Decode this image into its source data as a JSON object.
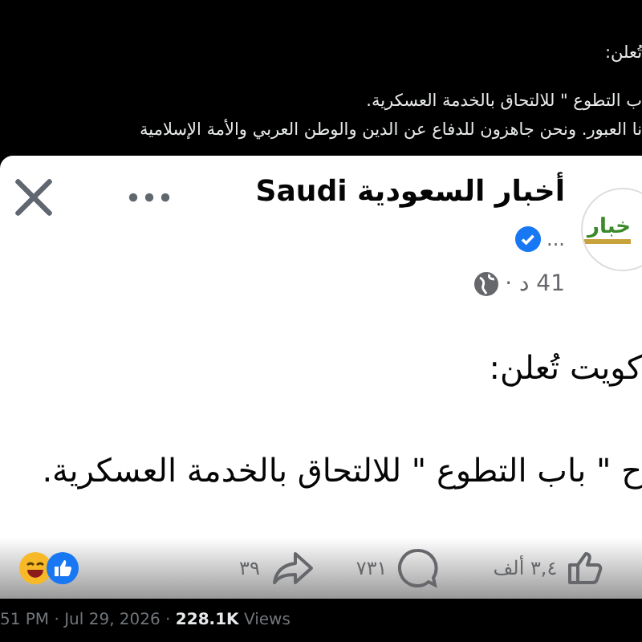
{
  "tweet_text": [
    "تُعلن:",
    "ب التطوع \" للالتحاق بالخدمة العسكرية.",
    "نا العبور. ونحن جاهزون  للدفاع عن الدين والوطن العربي والأمة الإسلامية"
  ],
  "post": {
    "avatar_text": "خبار",
    "page_name": "أخبار السعودية Saudi",
    "verified": true,
    "more": "...",
    "time": "41 د ·",
    "body": [
      "كويت تُعلن:",
      "ح \" باب التطوع \" للالتحاق بالخدمة العسكرية."
    ],
    "reactions_count": "٣,٤ ألف",
    "comments": "٧٣١",
    "shares": "٣٩"
  },
  "footer": {
    "time": "51 PM · Jul 29, 2026 · ",
    "views": "228.1K",
    "views_label": " Views"
  }
}
